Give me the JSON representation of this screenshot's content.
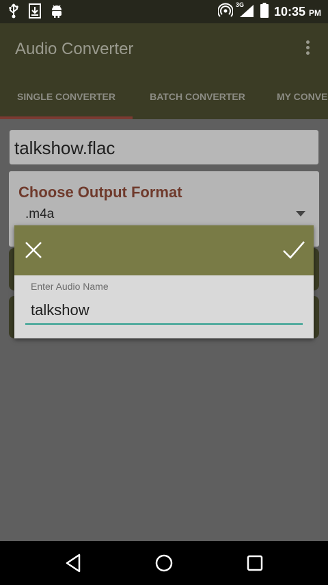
{
  "status_bar": {
    "time": "10:35",
    "ampm": "PM",
    "network": "3G",
    "icons": [
      "usb-icon",
      "download-icon",
      "android-icon",
      "hotspot-icon",
      "signal-icon",
      "battery-icon"
    ]
  },
  "app_bar": {
    "title": "Audio Converter",
    "overflow_icon": "more-vert-icon"
  },
  "tabs": [
    {
      "label": "SINGLE CONVERTER",
      "selected": true
    },
    {
      "label": "BATCH CONVERTER",
      "selected": false
    },
    {
      "label": "MY CONVERTER",
      "selected": false
    }
  ],
  "file": {
    "name": "talkshow.flac"
  },
  "format": {
    "title": "Choose Output Format",
    "selected": ".m4a"
  },
  "dialog": {
    "close_icon": "close-icon",
    "confirm_icon": "check-icon",
    "field_label": "Enter Audio Name",
    "field_value": "talkshow"
  },
  "nav_bar": {
    "icons": [
      "back-icon",
      "home-icon",
      "recents-icon"
    ]
  },
  "colors": {
    "status_bar": "#26271c",
    "app_bar": "#3b3c25",
    "tab_indicator": "#7b3a32",
    "dialog_header": "#797b46",
    "input_underline": "#2d9e8e",
    "format_title": "#6f3a2c"
  }
}
